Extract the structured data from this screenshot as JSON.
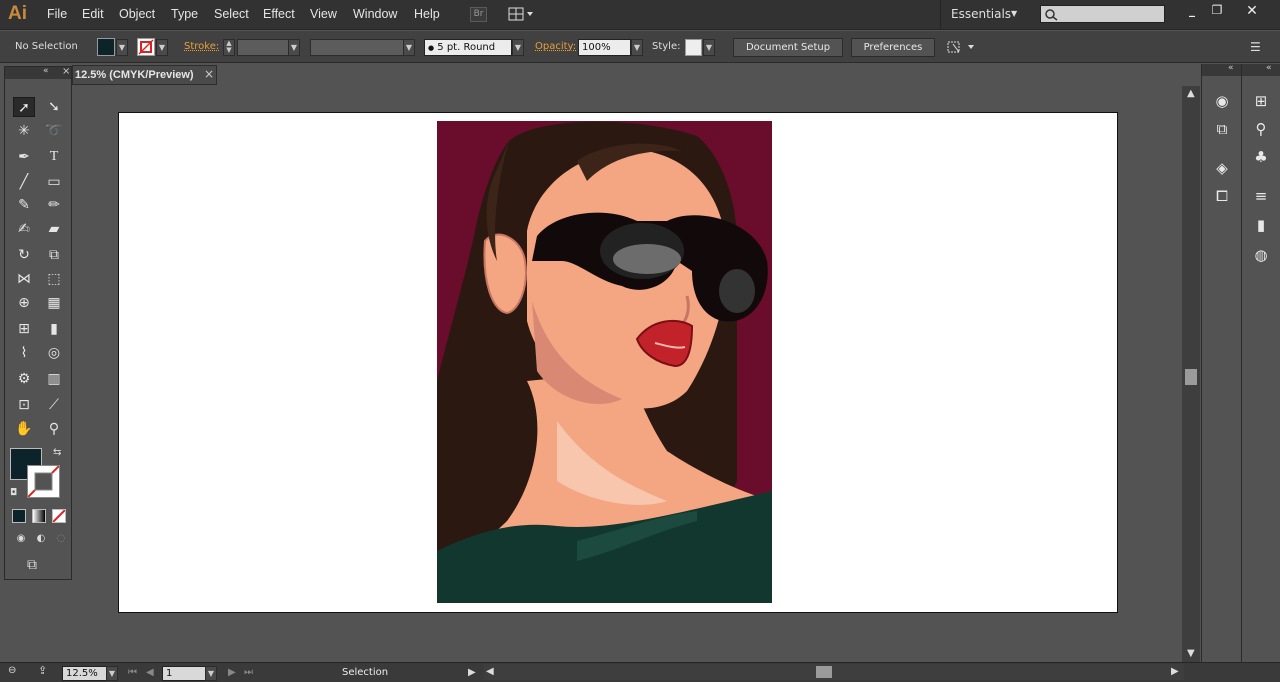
{
  "app": {
    "logo": "Ai",
    "menus": [
      "File",
      "Edit",
      "Object",
      "Type",
      "Select",
      "Effect",
      "View",
      "Window",
      "Help"
    ],
    "bridge_button": "Br",
    "workspace": "Essentials",
    "search_placeholder": ""
  },
  "control": {
    "selection_state": "No Selection",
    "stroke_label": "Stroke:",
    "brush_label": "5 pt. Round",
    "opacity_label": "Opacity:",
    "opacity_value": "100%",
    "style_label": "Style:",
    "document_setup": "Document Setup",
    "preferences": "Preferences"
  },
  "document": {
    "tab_title": "12.5% (CMYK/Preview)",
    "close_glyph": "×"
  },
  "status": {
    "zoom": "12.5%",
    "artboard_number": "1",
    "tool_status": "Selection"
  },
  "colors": {
    "fill": "#0c2329",
    "background": "#6a0c2c",
    "skin": "#f4a683",
    "hair": "#2a1811",
    "lips": "#c2232a",
    "shirt": "#12372f"
  }
}
